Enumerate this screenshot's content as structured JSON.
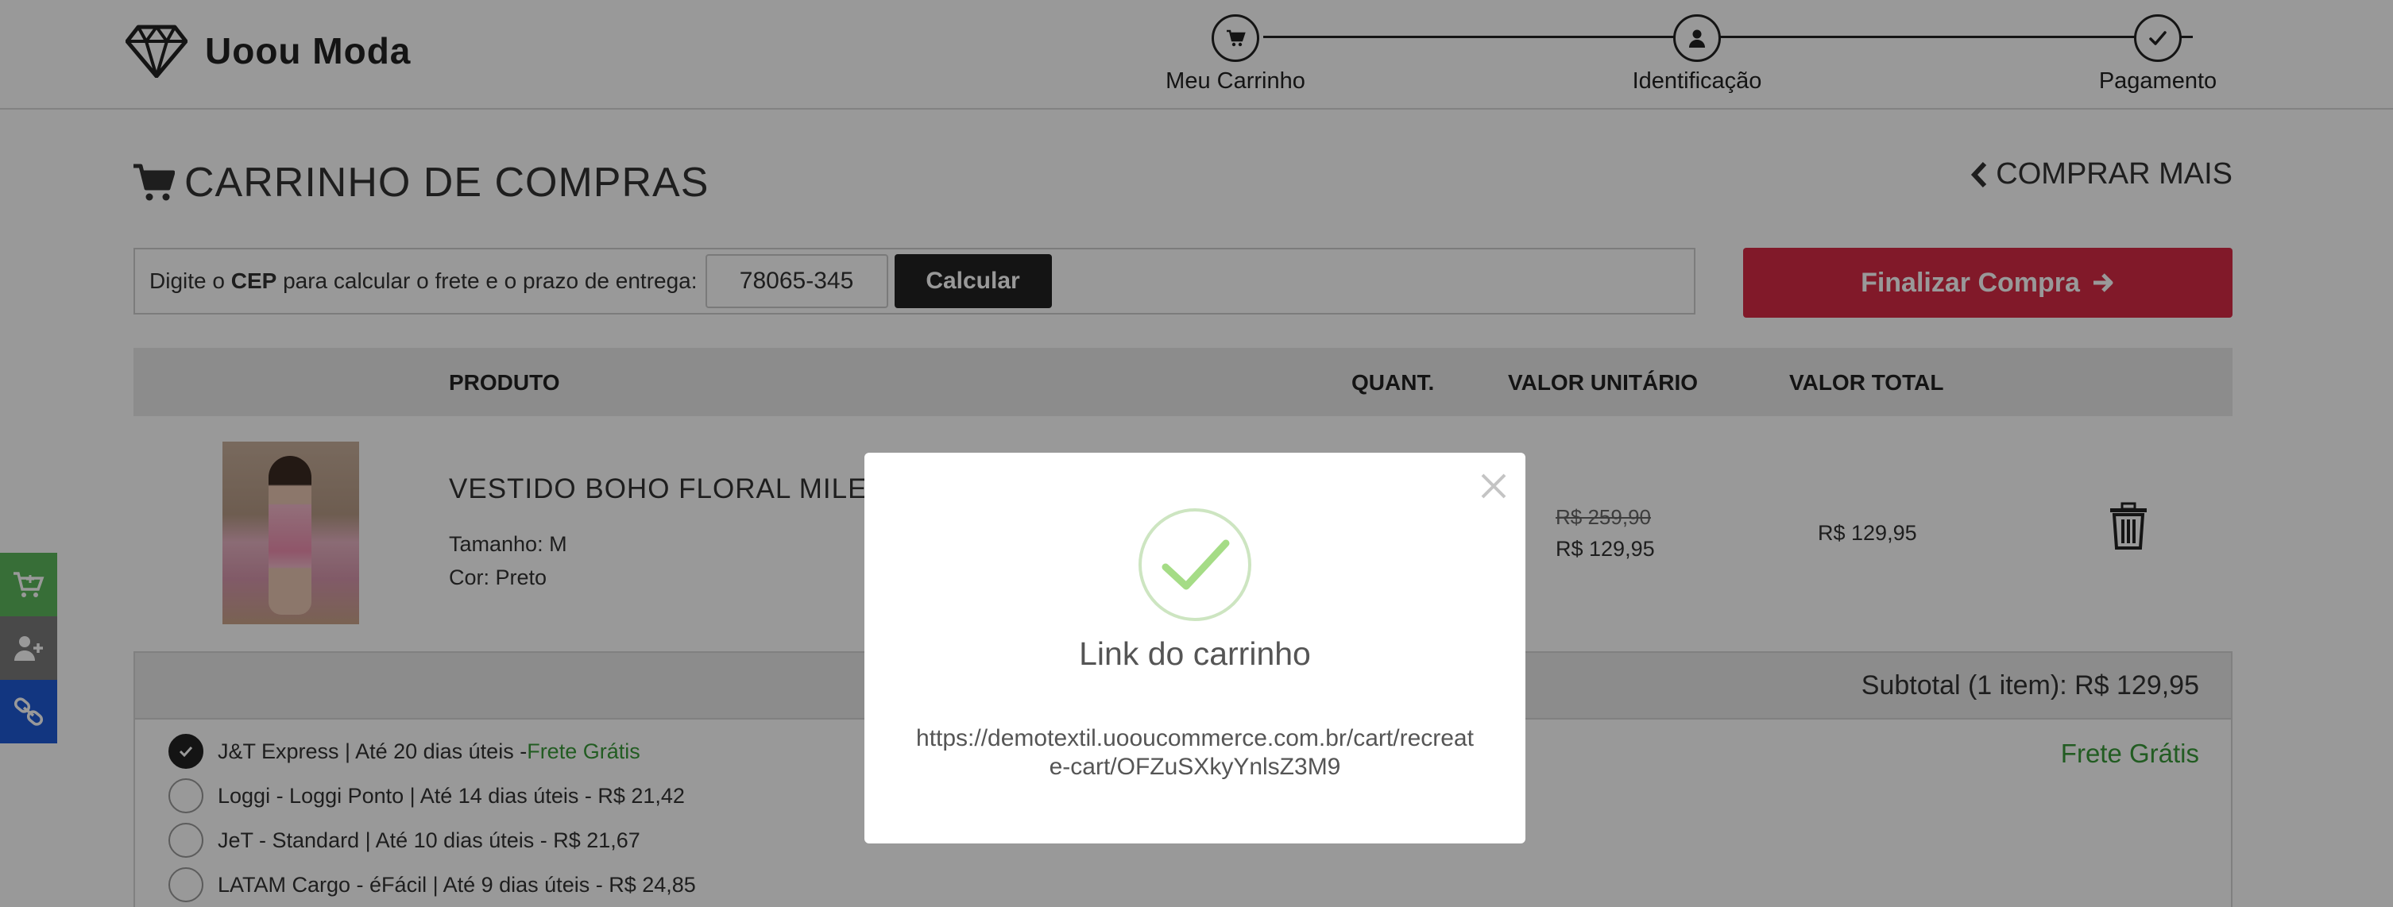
{
  "header": {
    "brand": "Uoou Moda",
    "steps": [
      {
        "label": "Meu Carrinho",
        "icon": "cart-icon"
      },
      {
        "label": "Identificação",
        "icon": "user-icon"
      },
      {
        "label": "Pagamento",
        "icon": "check-icon"
      }
    ]
  },
  "main": {
    "title": "CARRINHO DE COMPRAS",
    "buy_more": "COMPRAR MAIS",
    "cep": {
      "prefix": "Digite o ",
      "bold": "CEP",
      "suffix": " para calcular o frete e o prazo de entrega:",
      "value": "78065-345",
      "button": "Calcular"
    },
    "finalize": "Finalizar Compra",
    "table_headers": {
      "product": "PRODUTO",
      "qty": "QUANT.",
      "unit": "VALOR UNITÁRIO",
      "total": "VALOR TOTAL"
    },
    "item": {
      "name": "VESTIDO BOHO FLORAL MILENA",
      "size": "Tamanho: M",
      "color": "Cor: Preto",
      "old_price": "R$ 259,90",
      "unit_price": "R$ 129,95",
      "total_price": "R$ 129,95"
    },
    "subtotal": "Subtotal (1 item): R$ 129,95",
    "shipping": {
      "options": [
        {
          "text": "J&T Express | Até 20 dias úteis - ",
          "extra": "Frete Grátis",
          "checked": true
        },
        {
          "text": "Loggi - Loggi Ponto | Até 14 dias úteis - R$ 21,42",
          "extra": "",
          "checked": false
        },
        {
          "text": "JeT - Standard | Até 10 dias úteis - R$ 21,67",
          "extra": "",
          "checked": false
        },
        {
          "text": "LATAM Cargo - éFácil | Até 9 dias úteis - R$ 24,85",
          "extra": "",
          "checked": false
        }
      ],
      "selected_label": "Frete Grátis"
    }
  },
  "side_tabs": [
    {
      "icon": "cart-plus-icon",
      "color": "#5cb85c"
    },
    {
      "icon": "user-plus-icon",
      "color": "#7a7a7a"
    },
    {
      "icon": "link-icon",
      "color": "#1f5bd6"
    }
  ],
  "modal": {
    "title": "Link do carrinho",
    "url": "https://demotextil.uooucommerce.com.br/cart/recreate-cart/OFZuSXkyYnlsZ3M9"
  },
  "colors": {
    "accent": "#d82a45",
    "success": "#3a9a3a"
  }
}
